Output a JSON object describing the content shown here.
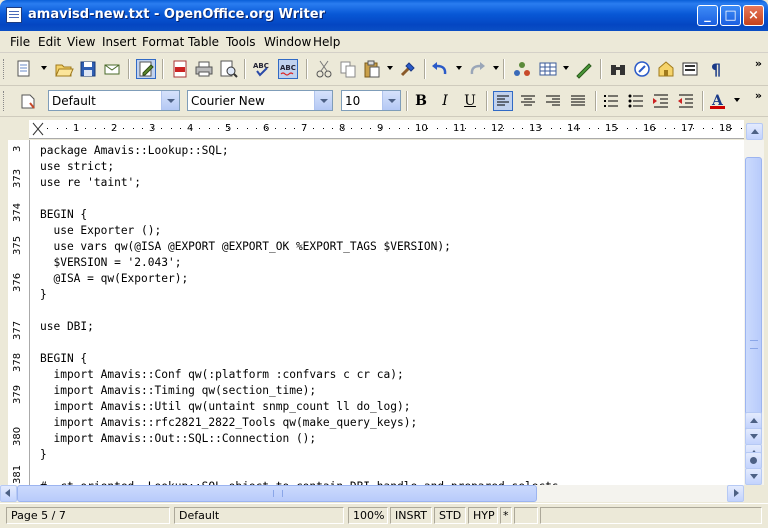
{
  "window": {
    "title": "amavisd-new.txt - OpenOffice.org Writer",
    "controls": [
      "minimize",
      "maximize",
      "close"
    ]
  },
  "menu": [
    "File",
    "Edit",
    "View",
    "Insert",
    "Format",
    "Table",
    "Tools",
    "Window",
    "Help"
  ],
  "toolbar_standard": {
    "icons": [
      "new-document-icon",
      "open-folder-icon",
      "save-icon",
      "email-icon",
      "edit-file-icon",
      "export-pdf-icon",
      "print-icon",
      "page-preview-icon",
      "spellcheck-icon",
      "autospellcheck-icon",
      "cut-icon",
      "copy-icon",
      "paste-icon",
      "clone-formatting-icon",
      "undo-icon",
      "redo-icon",
      "navigator-icon",
      "table-icon",
      "show-draw-icon",
      "find-icon",
      "gallery-icon",
      "datasources-icon",
      "field-shadings-icon",
      "pilcrow-icon"
    ]
  },
  "toolbar_formatting": {
    "paragraph_style": "Default",
    "font_name": "Courier New",
    "font_size": "10",
    "bold_label": "B",
    "italic_label": "I",
    "underline_label": "U"
  },
  "ruler": {
    "labels": [
      "1",
      "2",
      "3",
      "4",
      "5",
      "6",
      "7",
      "8",
      "9",
      "10",
      "11",
      "12",
      "13",
      "14",
      "15",
      "16",
      "17",
      "18"
    ]
  },
  "vertical_ruler": {
    "labels": [
      "3",
      "373",
      "374",
      "375",
      "376",
      "377",
      "378",
      "379",
      "380",
      "381"
    ]
  },
  "document": {
    "lines": [
      "package Amavis::Lookup::SQL;",
      "use strict;",
      "use re 'taint';",
      "",
      "BEGIN {",
      "  use Exporter ();",
      "  use vars qw(@ISA @EXPORT @EXPORT_OK %EXPORT_TAGS $VERSION);",
      "  $VERSION = '2.043';",
      "  @ISA = qw(Exporter);",
      "}",
      "",
      "use DBI;",
      "",
      "BEGIN {",
      "  import Amavis::Conf qw(:platform :confvars c cr ca);",
      "  import Amavis::Timing qw(section_time);",
      "  import Amavis::Util qw(untaint snmp_count ll do_log);",
      "  import Amavis::rfc2821_2822_Tools qw(make_query_keys);",
      "  import Amavis::Out::SQL::Connection ();",
      "}",
      "",
      "#  ct-oriented  Lookup::SQL object to contain DBI handle and prepared selects"
    ]
  },
  "status": {
    "page": "Page 5 / 7",
    "page_style": "Default",
    "zoom": "100%",
    "insert_mode": "INSRT",
    "selection_mode": "STD",
    "hyperlink_mode": "HYP",
    "modified": "*"
  }
}
